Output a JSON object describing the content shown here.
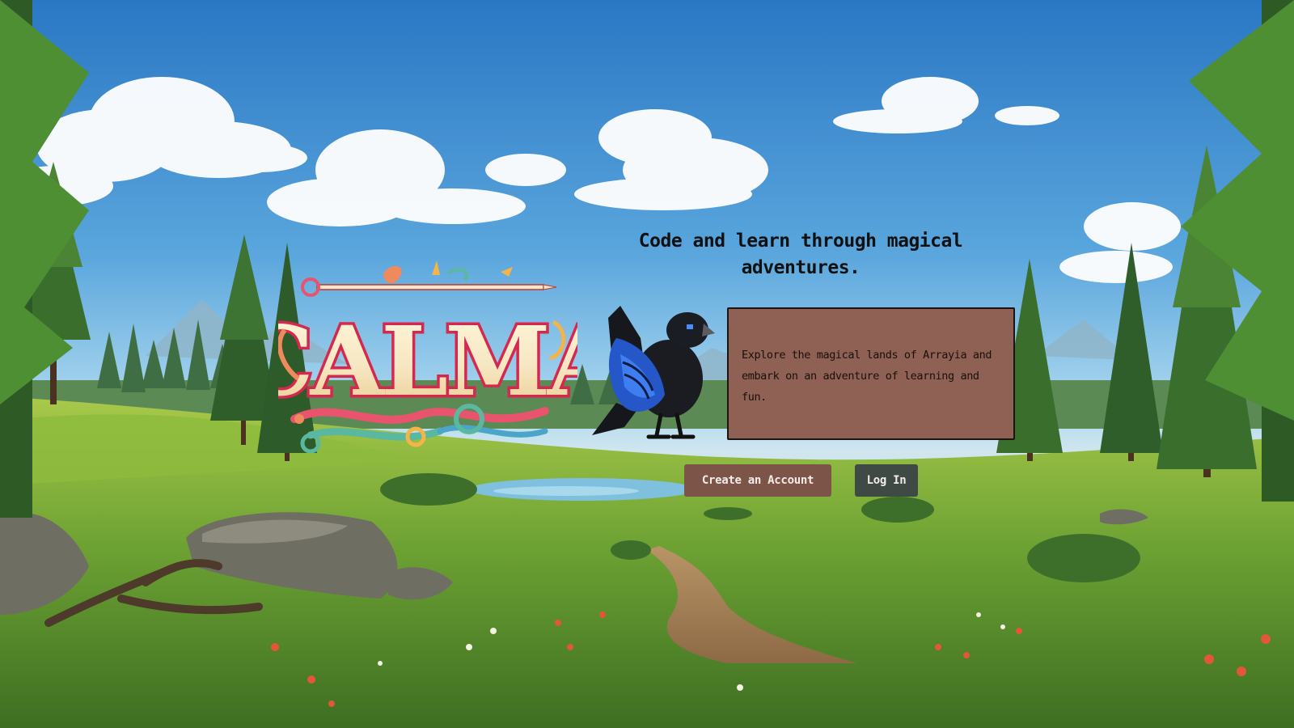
{
  "hero": {
    "headline": "Code and learn through magical adventures.",
    "description": "Explore the magical lands of Arrayia and embark on an adventure of learning and fun."
  },
  "logo": {
    "wordmark": "CALMA"
  },
  "actions": {
    "create_account_label": "Create an Account",
    "log_in_label": "Log In"
  },
  "colors": {
    "info_box_bg": "#8f6154",
    "create_button_bg": "#7d5548",
    "login_button_bg": "#3f4a44",
    "sky_top": "#2f7fc9",
    "grass": "#7fb33a"
  },
  "icons": [
    "raven-icon",
    "calma-logo"
  ]
}
